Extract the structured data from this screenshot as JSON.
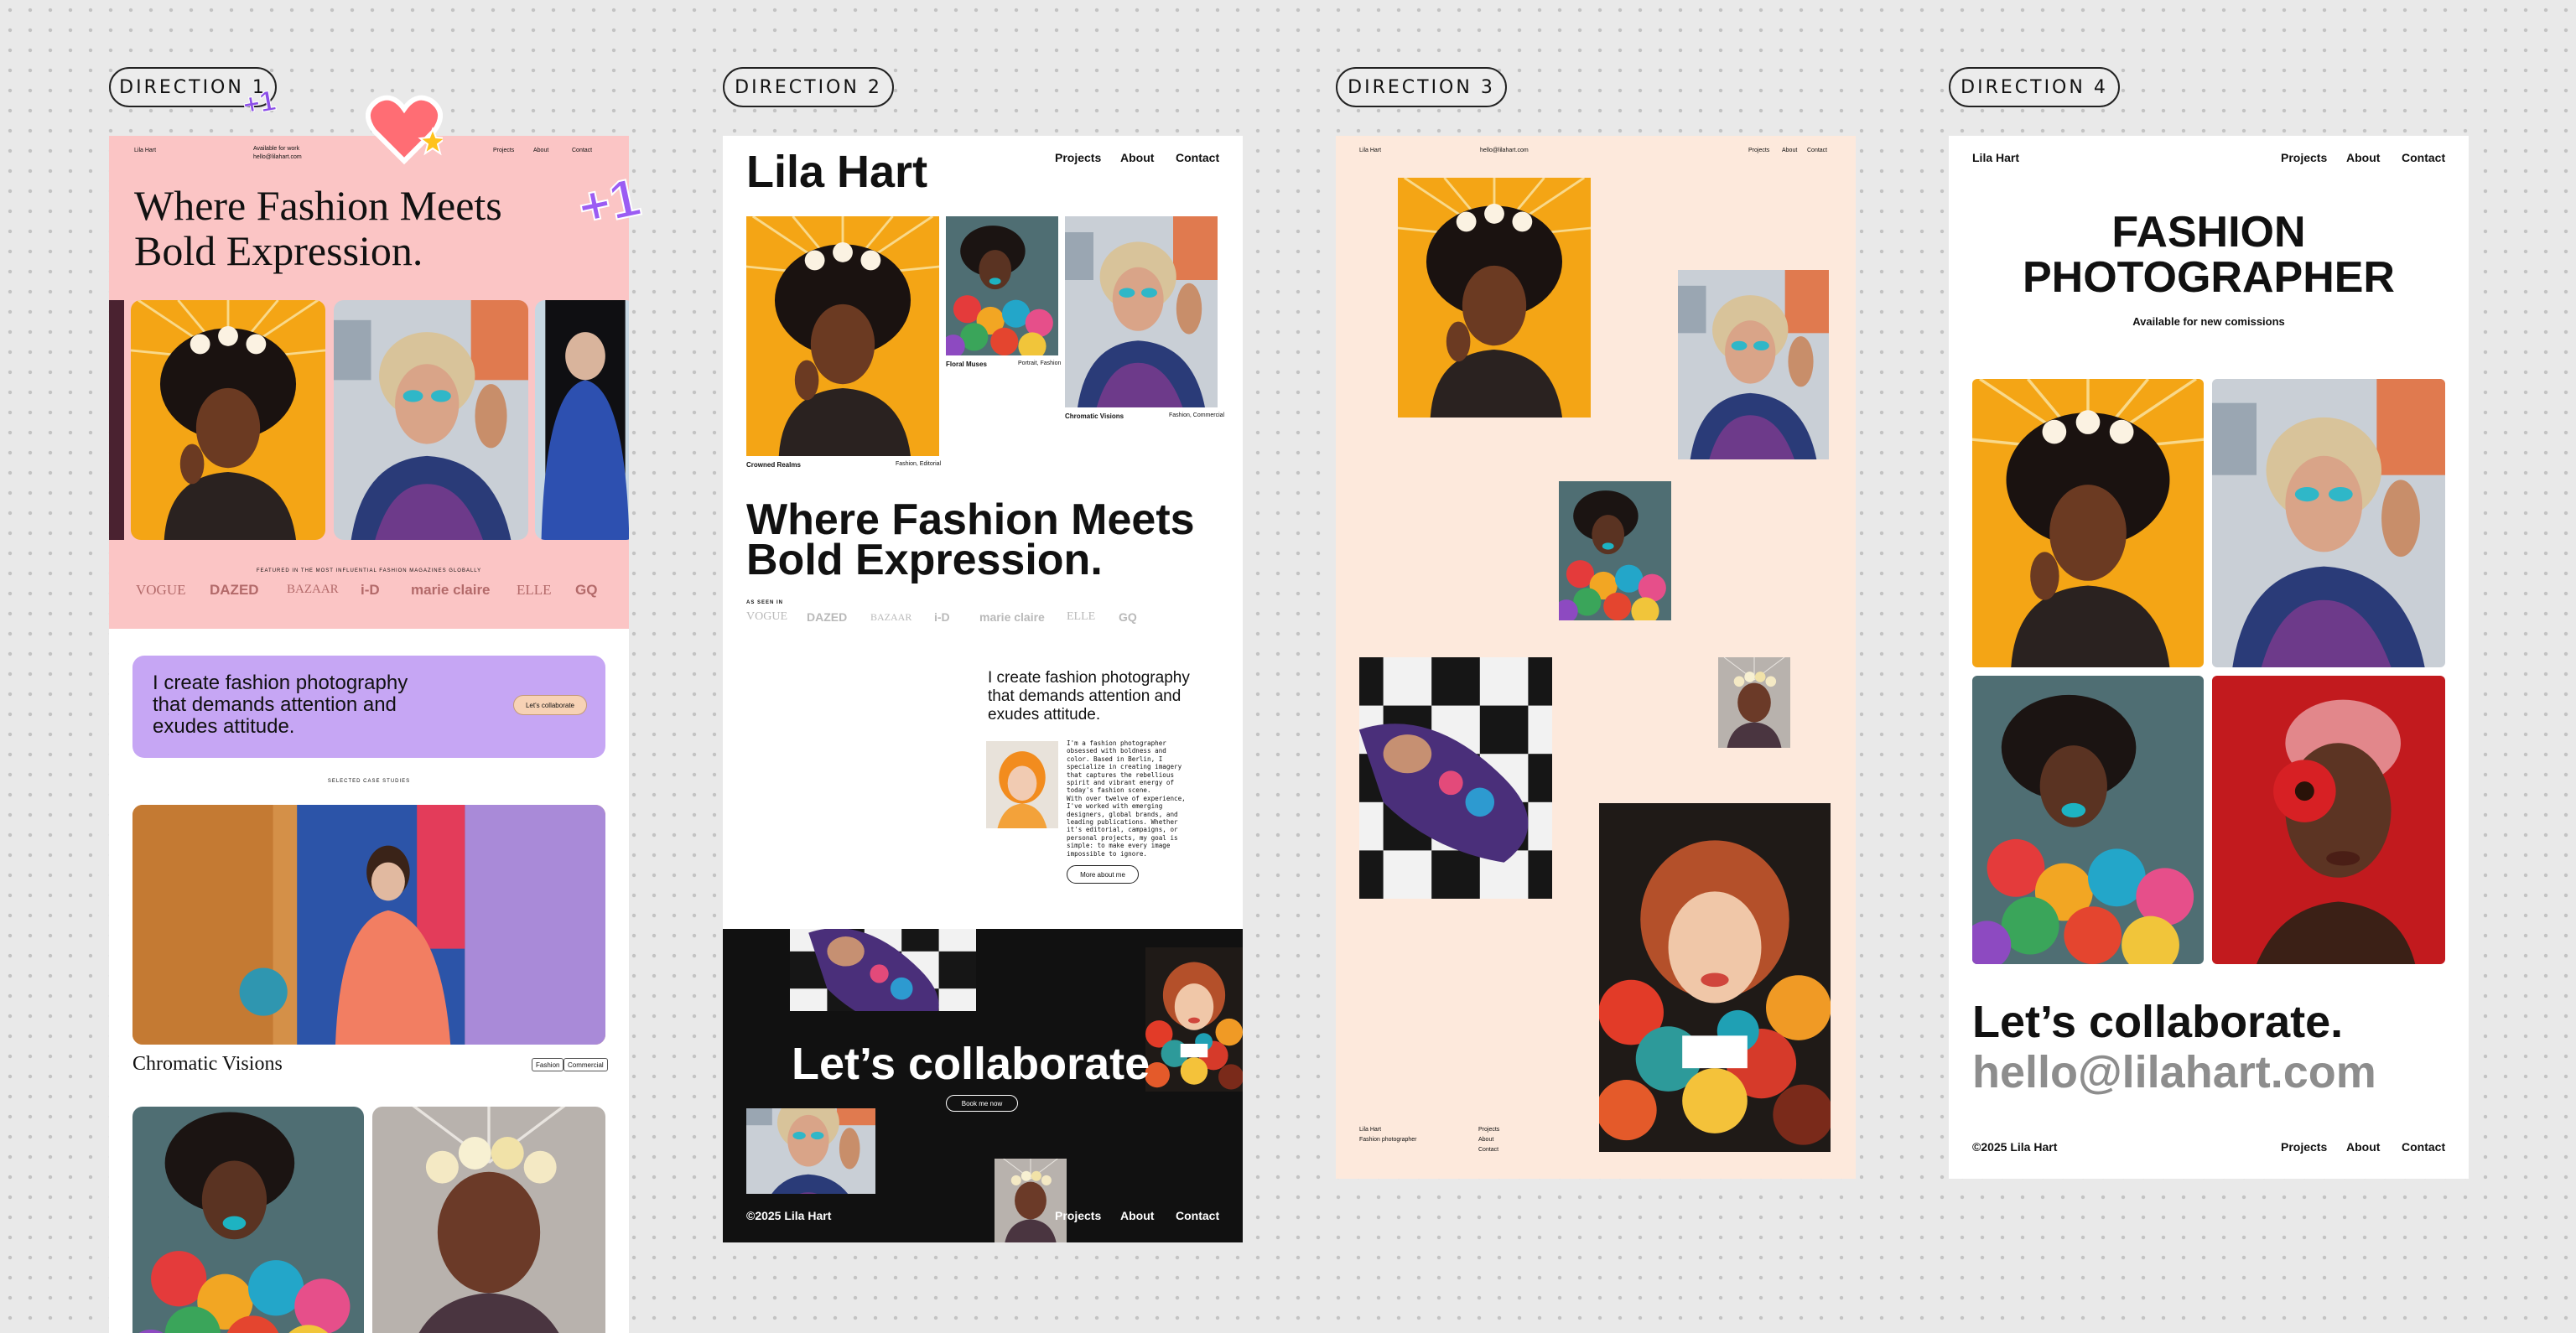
{
  "labels": [
    "DIRECTION 1",
    "DIRECTION 2",
    "DIRECTION 3",
    "DIRECTION 4"
  ],
  "stickers": {
    "plus_small": "+1",
    "plus_large": "+1"
  },
  "d1": {
    "brand": "Lila Hart",
    "available": "Available for work",
    "email": "hello@lilahart.com",
    "nav": [
      "Projects",
      "About",
      "Contact"
    ],
    "headline": [
      "Where Fashion Meets",
      "Bold Expression."
    ],
    "featured": "FEATURED IN THE MOST INFLUENTIAL FASHION MAGAZINES GLOBALLY",
    "magazines": [
      "VOGUE",
      "DAZED",
      "BAZAAR",
      "i-D",
      "marie claire",
      "ELLE",
      "GQ"
    ],
    "intro": [
      "I create fashion photography",
      "that demands attention and",
      "exudes attitude."
    ],
    "cta": "Let's collaborate",
    "case_label": "SELECTED CASE STUDIES",
    "case_title": "Chromatic Visions",
    "case_tags": [
      "Fashion",
      "Commercial"
    ]
  },
  "d2": {
    "brand": "Lila Hart",
    "nav": [
      "Projects",
      "About",
      "Contact"
    ],
    "projects": [
      {
        "title": "Crowned Realms",
        "tags": "Fashion, Editorial"
      },
      {
        "title": "Floral Muses",
        "tags": "Portrait, Fashion"
      },
      {
        "title": "Chromatic Visions",
        "tags": "Fashion, Commercial"
      }
    ],
    "headline": [
      "Where Fashion Meets",
      "Bold Expression."
    ],
    "seen_in": "AS SEEN IN",
    "magazines": [
      "VOGUE",
      "DAZED",
      "BAZAAR",
      "i-D",
      "marie claire",
      "ELLE",
      "GQ"
    ],
    "intro": [
      "I create fashion photography",
      "that demands attention and",
      "exudes attitude."
    ],
    "bio": [
      "I'm a fashion photographer",
      "obsessed with boldness and",
      "color. Based in Berlin, I",
      "specialize in creating imagery",
      "that captures the rebellious",
      "spirit and vibrant energy of",
      "today's fashion scene.",
      "With over twelve of experience,",
      "I've worked with emerging",
      "designers, global brands, and",
      "leading publications. Whether",
      "it's editorial, campaigns, or",
      "personal projects, my goal is",
      "simple: to make every image",
      "impossible to ignore."
    ],
    "more_about": "More about me",
    "cta_title": "Let’s collaborate",
    "book": "Book me now",
    "copyright": "©2025 Lila Hart",
    "footer_nav": [
      "Projects",
      "About",
      "Contact"
    ]
  },
  "d3": {
    "brand": "Lila Hart",
    "email": "hello@lilahart.com",
    "nav": [
      "Projects",
      "About",
      "Contact"
    ],
    "footer_brand": [
      "Lila Hart",
      "Fashion photographer"
    ],
    "footer_nav": [
      "Projects",
      "About",
      "Contact"
    ]
  },
  "d4": {
    "brand": "Lila Hart",
    "nav": [
      "Projects",
      "About",
      "Contact"
    ],
    "title": [
      "FASHION",
      "PHOTOGRAPHER"
    ],
    "subtitle": "Available for new comissions",
    "cta": "Let’s collaborate.",
    "email": "hello@lilahart.com",
    "copyright": "©2025 Lila Hart",
    "footer_nav": [
      "Projects",
      "About",
      "Contact"
    ]
  },
  "colors": {
    "d1_bg": "#fbc5c5",
    "d1_card": "#c6a6f4",
    "d3_bg": "#fde9dc",
    "d2_dark": "#111111",
    "accent_orange": "#f4a11a"
  }
}
